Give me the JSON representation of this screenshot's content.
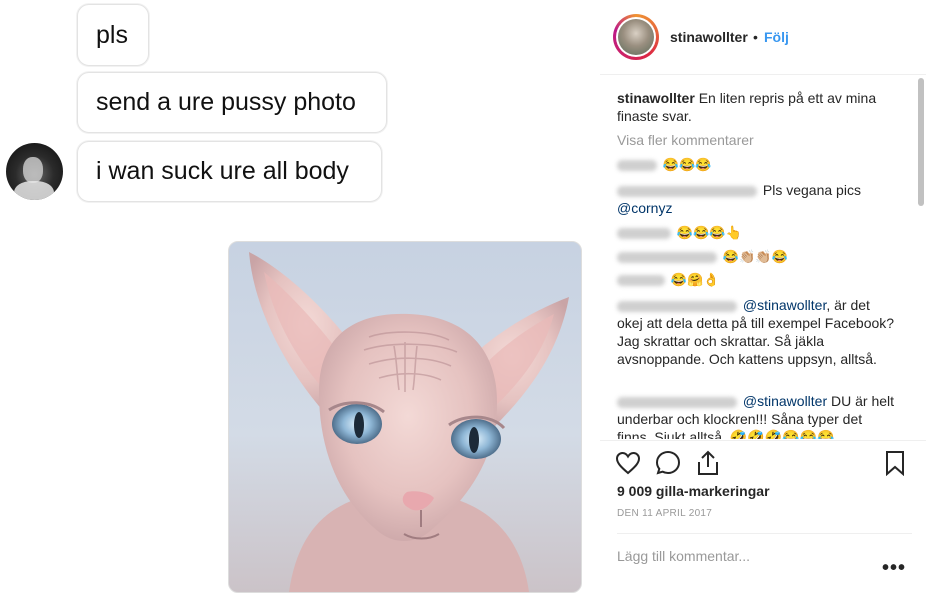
{
  "chat": {
    "messages": [
      "pls",
      "send a ure pussy photo",
      "i wan suck ure all body"
    ]
  },
  "post": {
    "username": "stinawollter",
    "separator": "•",
    "follow_label": "Följ",
    "caption_user": "stinawollter",
    "caption_text": "En liten repris på ett av mina finaste svar.",
    "view_more": "Visa fler kommentarer",
    "comments": [
      {
        "emoji": "😂😂😂"
      },
      {
        "text": "Pls vegana pics",
        "mention": "@cornyz"
      },
      {
        "emoji": "😂😂😂👆"
      },
      {
        "emoji": "😂👏🏼👏🏼😂"
      },
      {
        "emoji": "😂🤗👌"
      },
      {
        "mention": "@stinawollter",
        "text": ", är det okej att dela detta på till exempel Facebook? Jag skrattar och skrattar. Så jäkla avsnoppande. Och kattens uppsyn, alltså."
      },
      {
        "mention": "@stinawollter",
        "text": " DU är helt underbar och klockren!!! Såna typer det finns. Sjukt alltså. 🤣🤣🤣😂😂😂"
      }
    ],
    "likes": "9 009 gilla-markeringar",
    "date": "DEN 11 APRIL 2017",
    "add_comment_placeholder": "Lägg till kommentar...",
    "more_options": "•••"
  }
}
